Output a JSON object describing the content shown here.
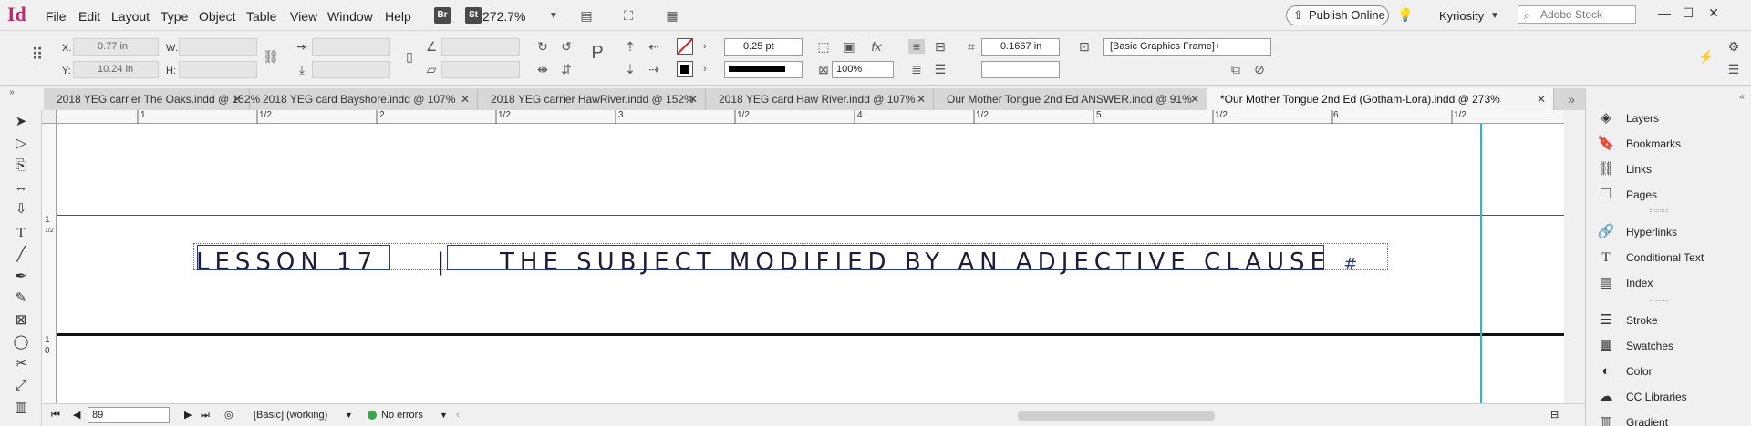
{
  "menubar": {
    "app_logo": "Id",
    "items": [
      "File",
      "Edit",
      "Layout",
      "Type",
      "Object",
      "Table",
      "View",
      "Window",
      "Help"
    ],
    "bridge_badge": "Br",
    "stock_badge": "St",
    "zoom": "272.7%",
    "publish_label": "Publish Online",
    "user": "Kyriosity",
    "stock_placeholder": "Adobe Stock"
  },
  "control_panel": {
    "x_label": "X:",
    "x_value": "0.77 in",
    "y_label": "Y:",
    "y_value": "10.24 in",
    "w_label": "W:",
    "h_label": "H:",
    "stroke_weight": "0.25 pt",
    "opacity": "100%",
    "offset": "0.1667 in",
    "object_style": "[Basic Graphics Frame]+"
  },
  "tabs": [
    {
      "label": "2018 YEG carrier The Oaks.indd @ 152%",
      "active": false
    },
    {
      "label": "2018 YEG card Bayshore.indd @ 107%",
      "active": false
    },
    {
      "label": "2018 YEG carrier HawRiver.indd @ 152%",
      "active": false
    },
    {
      "label": "2018 YEG card Haw River.indd @ 107%",
      "active": false
    },
    {
      "label": "Our Mother Tongue 2nd Ed ANSWER.indd @ 91%",
      "active": false
    },
    {
      "label": "*Our Mother Tongue 2nd Ed (Gotham-Lora).indd @ 273%",
      "active": true
    }
  ],
  "ruler": {
    "top_labels": [
      "1",
      "1/2",
      "2",
      "1/2",
      "3",
      "1/2",
      "4",
      "1/2",
      "5",
      "1/2",
      "6",
      "1/2"
    ],
    "left_labels": [
      "1",
      "1/2",
      "1",
      "0"
    ]
  },
  "canvas": {
    "lesson_label": "LESSON 17",
    "separator": "|",
    "heading": "THE SUBJECT MODIFIED BY AN ADJECTIVE CLAUSE",
    "end_mark": "#"
  },
  "statusbar": {
    "page": "89",
    "profile": "[Basic] (working)",
    "preflight": "No errors"
  },
  "panels": [
    {
      "label": "Layers",
      "icon": "layers-icon"
    },
    {
      "label": "Bookmarks",
      "icon": "bookmark-icon"
    },
    {
      "label": "Links",
      "icon": "links-icon"
    },
    {
      "label": "Pages",
      "icon": "pages-icon"
    },
    {
      "label": "Hyperlinks",
      "icon": "hyperlinks-icon"
    },
    {
      "label": "Conditional Text",
      "icon": "conditional-text-icon"
    },
    {
      "label": "Index",
      "icon": "index-icon"
    },
    {
      "label": "Stroke",
      "icon": "stroke-icon"
    },
    {
      "label": "Swatches",
      "icon": "swatches-icon"
    },
    {
      "label": "Color",
      "icon": "color-icon"
    },
    {
      "label": "CC Libraries",
      "icon": "cc-libraries-icon"
    },
    {
      "label": "Gradient",
      "icon": "gradient-icon"
    }
  ],
  "colors": {
    "app_accent": "#c0296b",
    "frame_blue": "#2b3a8c",
    "guide_cyan": "#29b6d6",
    "preflight_ok": "#3aa54b"
  }
}
